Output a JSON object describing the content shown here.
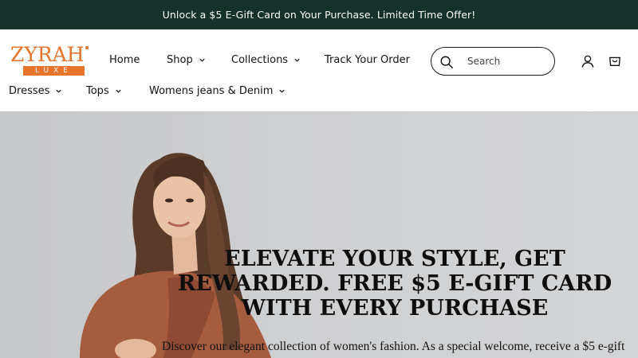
{
  "announcement": {
    "text": "Unlock a $5 E-Gift Card on Your Purchase. Limited Time Offer!"
  },
  "logo": {
    "name": "ZYRAH",
    "tagline": "LUXE"
  },
  "nav": {
    "home": "Home",
    "shop": "Shop",
    "collections": "Collections",
    "track_order": "Track Your Order",
    "dresses": "Dresses",
    "tops": "Tops",
    "jeans": "Womens jeans & Denim"
  },
  "search": {
    "placeholder": "Search"
  },
  "hero": {
    "title": "ELEVATE YOUR STYLE, GET REWARDED. FREE $5 E-GIFT CARD WITH EVERY PURCHASE",
    "subtitle": "Discover our elegant collection of women's fashion. As a special welcome, receive a $5 e-gift"
  },
  "colors": {
    "announcement_bg": "#14312a",
    "brand_orange": "#e8732a",
    "hero_bg": "#cfd0d2"
  },
  "icons": [
    "chevron-down-icon",
    "search-icon",
    "account-icon",
    "cart-icon"
  ]
}
